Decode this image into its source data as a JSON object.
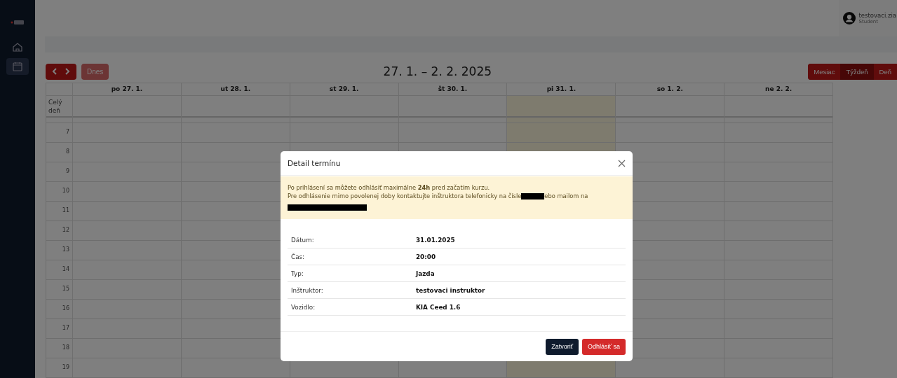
{
  "sidebar": {
    "items": [
      {
        "selected": false
      },
      {
        "selected": true
      }
    ]
  },
  "user": {
    "name": "testovaci.zia",
    "role": "Student"
  },
  "toolbar": {
    "today_button": "Dnes",
    "range_title": "27. 1. – 2. 2. 2025",
    "views": [
      {
        "label": "Mesiac",
        "selected": false
      },
      {
        "label": "Týždeň",
        "selected": true
      },
      {
        "label": "Deň",
        "selected": false
      }
    ]
  },
  "calendar": {
    "all_day_label": "Celý deň",
    "days": [
      {
        "label": "po 27. 1.",
        "today": false
      },
      {
        "label": "ut 28. 1.",
        "today": false
      },
      {
        "label": "st 29. 1.",
        "today": false
      },
      {
        "label": "št 30. 1.",
        "today": false
      },
      {
        "label": "pi 31. 1.",
        "today": true
      },
      {
        "label": "so 1. 2.",
        "today": false
      },
      {
        "label": "ne 2. 2.",
        "today": false
      }
    ],
    "hours": [
      "7",
      "8",
      "9",
      "10",
      "11",
      "12",
      "13",
      "14",
      "15",
      "16",
      "17",
      "18",
      "19"
    ]
  },
  "modal": {
    "title": "Detail termínu",
    "notice": {
      "line_1": "Po prihlásení sa môžete odhlásiť maximálne **24h** pred začatím kurzu.",
      "line_2_before": "Pre odhlásenie mimo povolenej doby kontaktujte inštruktora telefonicky na čísle",
      "line_2_after": "ebo mailom na"
    },
    "details": [
      {
        "label": "Dátum:",
        "value": "31.01.2025"
      },
      {
        "label": "Čas:",
        "value": "20:00"
      },
      {
        "label": "Typ:",
        "value": "Jazda"
      },
      {
        "label": "Inštruktor:",
        "value": "testovaci instruktor"
      },
      {
        "label": "Vozidlo:",
        "value": "KIA Ceed 1.6"
      }
    ],
    "buttons": [
      {
        "label": "Zatvoriť",
        "kind": "secondary"
      },
      {
        "label": "Odhlásiť sa",
        "kind": "danger"
      }
    ]
  }
}
